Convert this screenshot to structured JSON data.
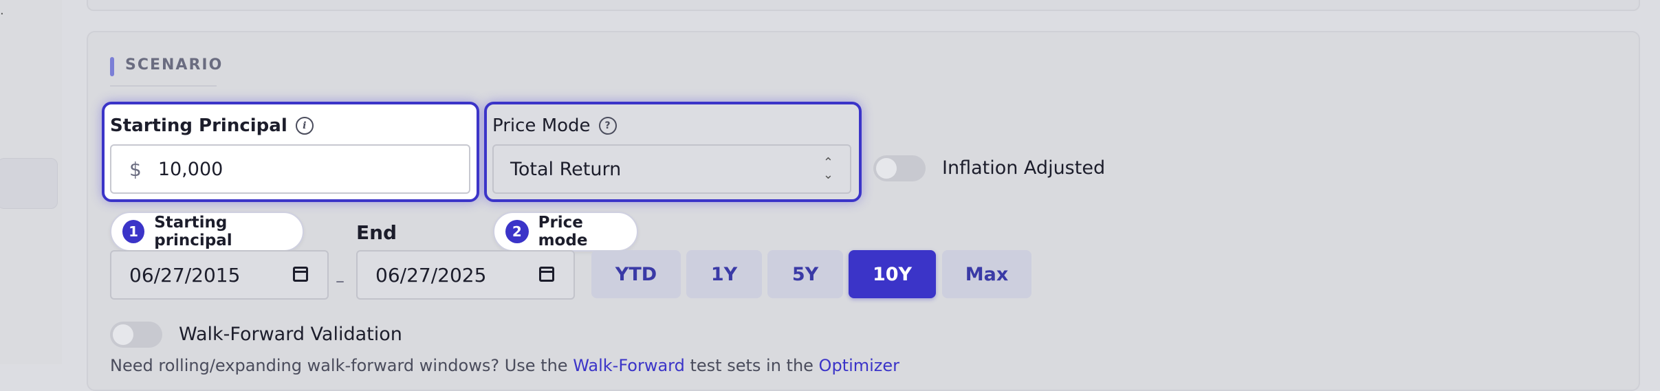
{
  "section": {
    "title": "SCENARIO"
  },
  "principal": {
    "label": "Starting Principal",
    "currency_symbol": "$",
    "value": "10,000",
    "info_icon": "info-icon"
  },
  "price_mode": {
    "label": "Price Mode",
    "selected": "Total Return",
    "help_icon": "help-icon"
  },
  "inflation": {
    "label": "Inflation Adjusted",
    "on": false
  },
  "tour_steps": [
    {
      "num": "1",
      "label": "Starting principal"
    },
    {
      "num": "2",
      "label": "Price mode"
    }
  ],
  "dates": {
    "end_label": "End",
    "start_value": "06/27/2015",
    "end_value": "06/27/2025",
    "separator": "–"
  },
  "range_buttons": [
    {
      "label": "YTD",
      "active": false
    },
    {
      "label": "1Y",
      "active": false
    },
    {
      "label": "5Y",
      "active": false
    },
    {
      "label": "10Y",
      "active": true
    },
    {
      "label": "Max",
      "active": false
    }
  ],
  "walk_forward": {
    "label": "Walk-Forward Validation",
    "on": false
  },
  "hint": {
    "prefix": "Need rolling/expanding walk-forward windows? Use the ",
    "link1": "Walk-Forward",
    "middle": " test sets in the ",
    "link2": "Optimizer"
  },
  "colors": {
    "accent": "#3b34c8",
    "background": "#dcdde2"
  }
}
